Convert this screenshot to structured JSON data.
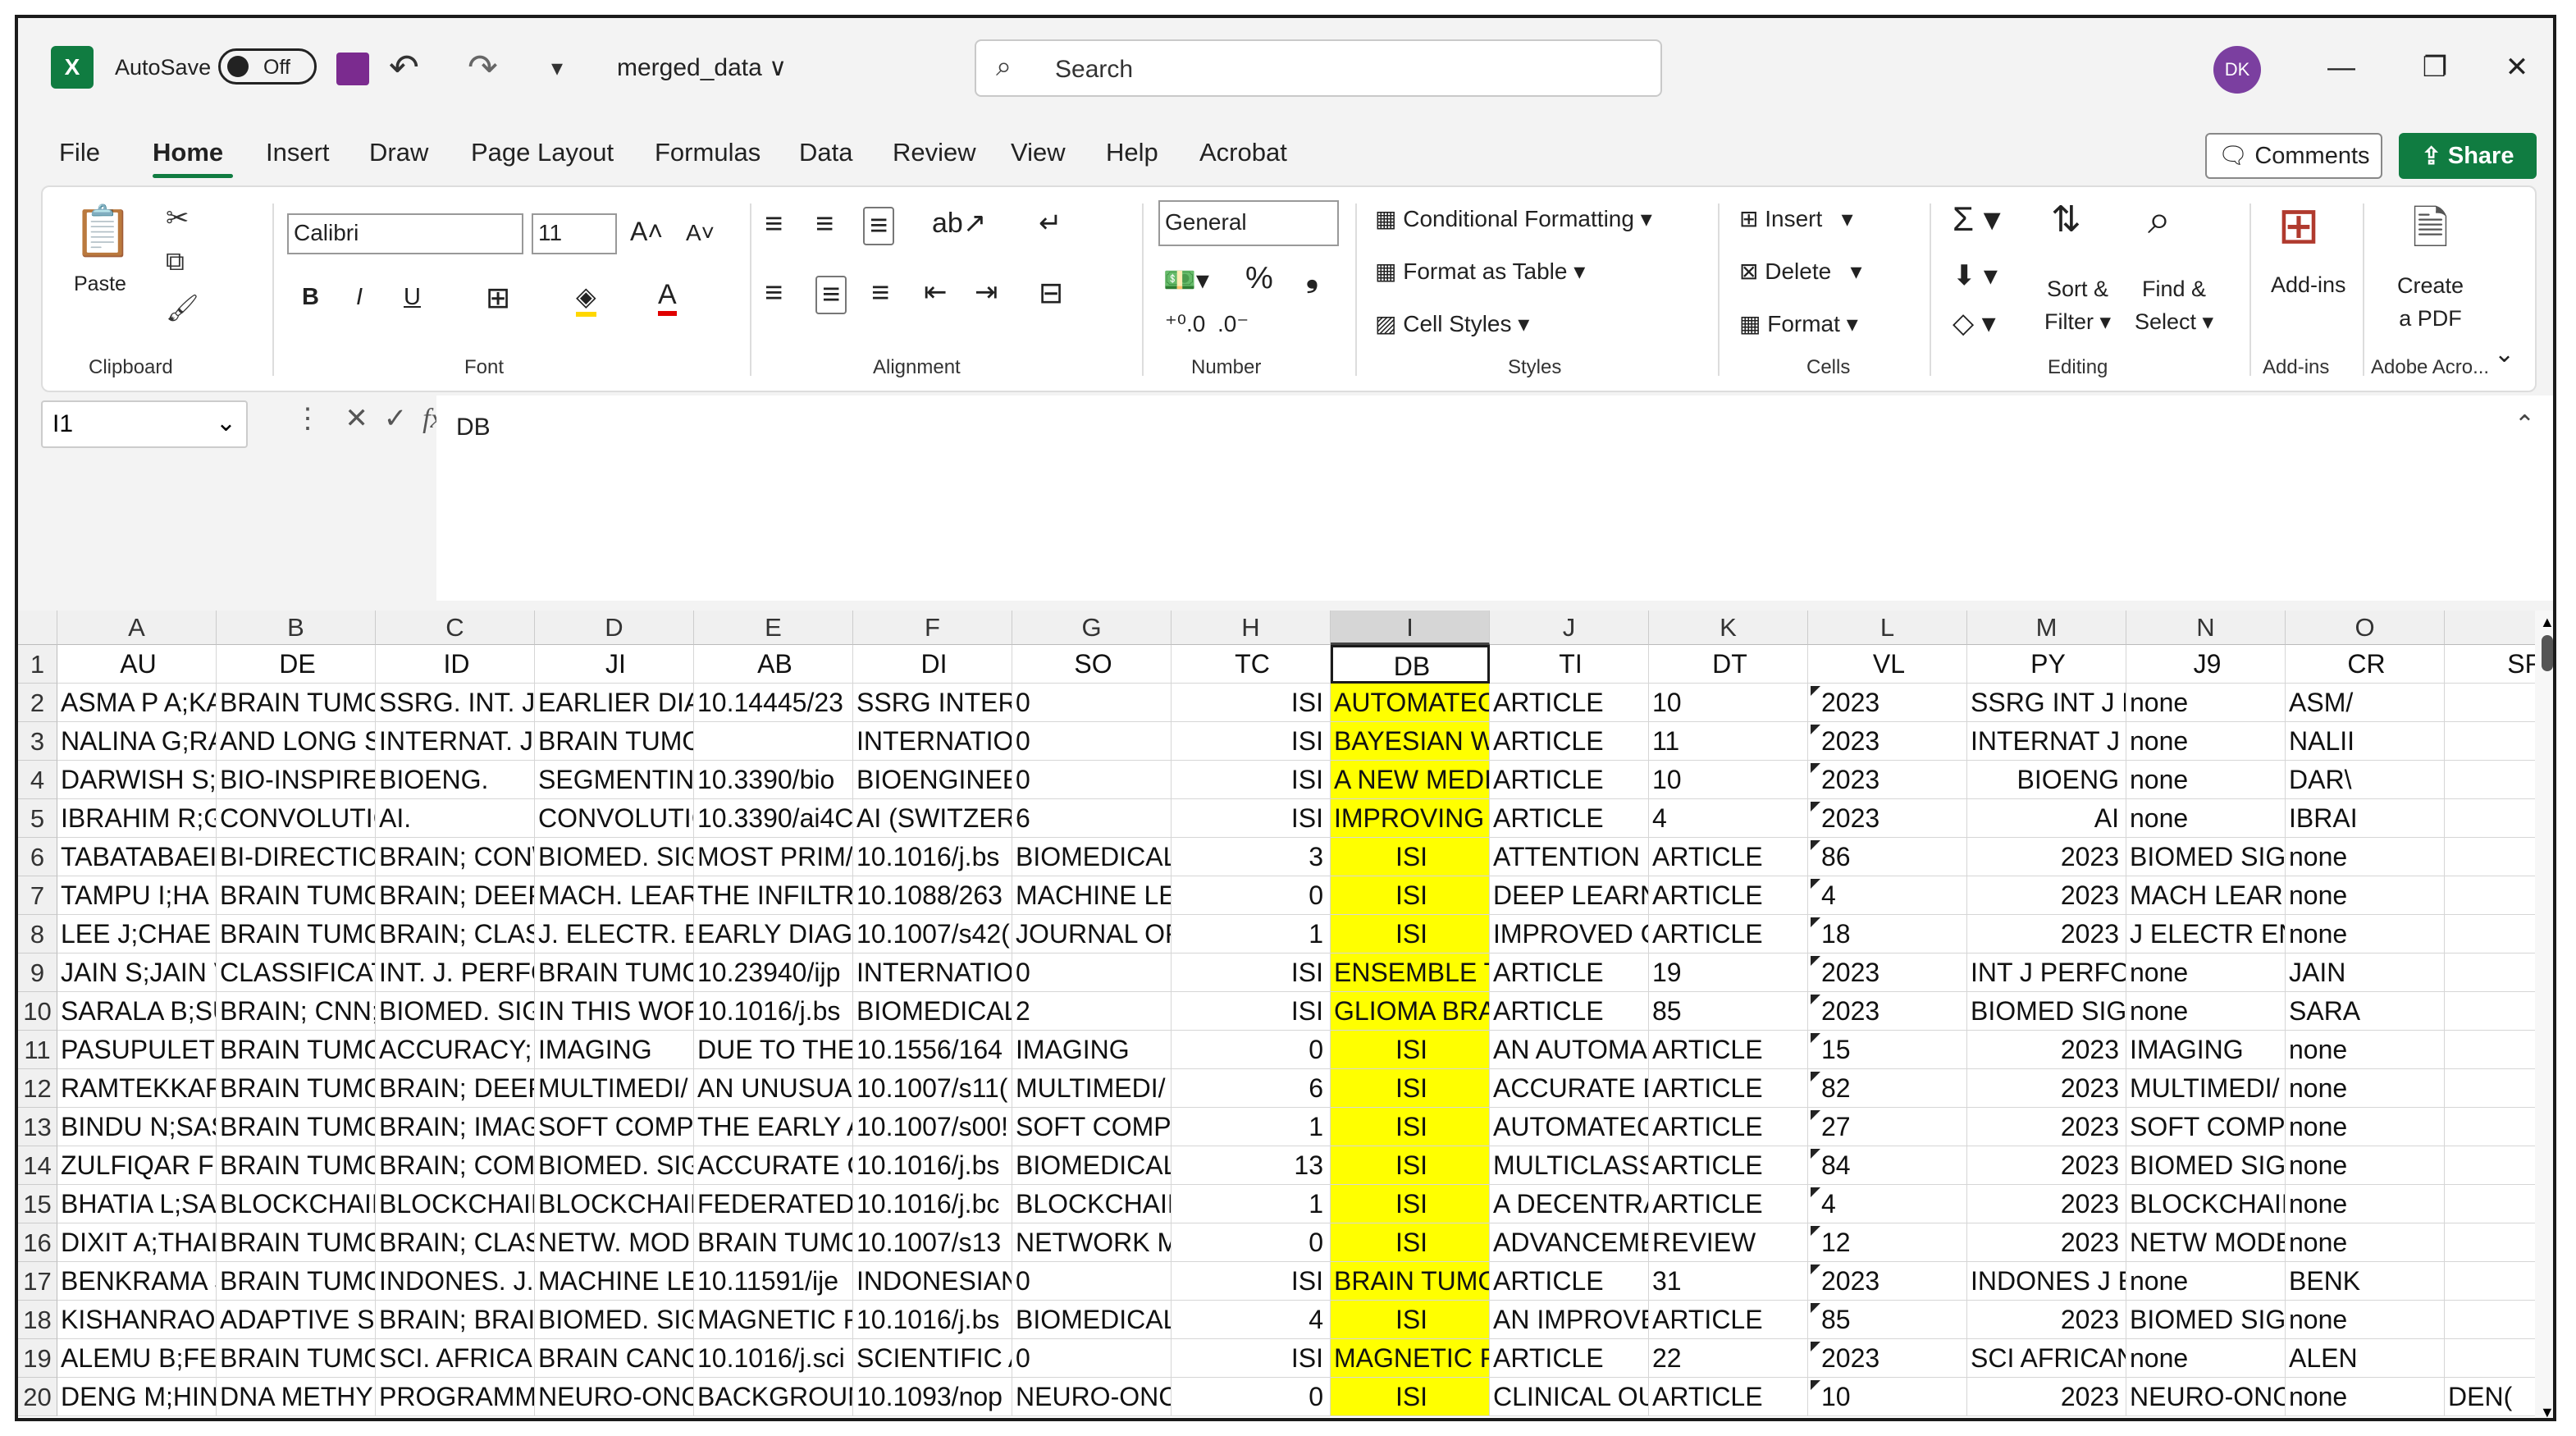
{
  "titlebar": {
    "autosave_label": "AutoSave",
    "autosave_state": "Off",
    "file_title": "merged_data ∨",
    "search_placeholder": "Search",
    "avatar_initials": "DK"
  },
  "tabs": [
    "File",
    "Home",
    "Insert",
    "Draw",
    "Page Layout",
    "Formulas",
    "Data",
    "Review",
    "View",
    "Help",
    "Acrobat"
  ],
  "active_tab": "Home",
  "actions": {
    "comments": "Comments",
    "share": "Share"
  },
  "ribbon": {
    "clipboard": {
      "paste": "Paste",
      "label": "Clipboard"
    },
    "font": {
      "name": "Calibri",
      "size": "11",
      "label": "Font"
    },
    "alignment": {
      "label": "Alignment"
    },
    "number": {
      "format": "General",
      "label": "Number"
    },
    "styles": {
      "conditional": "Conditional Formatting",
      "table": "Format as Table",
      "cell": "Cell Styles",
      "label": "Styles"
    },
    "cells": {
      "insert": "Insert",
      "delete": "Delete",
      "format": "Format",
      "label": "Cells"
    },
    "editing": {
      "sort": "Sort &",
      "sort2": "Filter",
      "find": "Find &",
      "find2": "Select",
      "label": "Editing"
    },
    "addins": {
      "btn": "Add-ins",
      "label": "Add-ins"
    },
    "adobe": {
      "btn1": "Create",
      "btn2": "a PDF",
      "label": "Adobe Acro..."
    }
  },
  "formula_bar": {
    "name_box": "I1",
    "formula": "DB"
  },
  "sheet": {
    "columns": [
      "A",
      "B",
      "C",
      "D",
      "E",
      "F",
      "G",
      "H",
      "I",
      "J",
      "K",
      "L",
      "M",
      "N",
      "O",
      ""
    ],
    "selected_column": "I",
    "header_row": [
      "AU",
      "DE",
      "ID",
      "JI",
      "AB",
      "DI",
      "SO",
      "TC",
      "DB",
      "TI",
      "DT",
      "VL",
      "PY",
      "J9",
      "CR",
      "SR"
    ],
    "rows": [
      [
        "ASMA P A;KA",
        "BRAIN TUMOUR; COMPUT",
        "SSRG. INT. J.",
        "EARLIER DIA(",
        "10.14445/23",
        "SSRG INTERN",
        "0",
        "ISI",
        "AUTOMATEC",
        "ARTICLE",
        "10",
        "2023",
        "SSRG INT J EL",
        "none",
        "ASM/"
      ],
      [
        "NALINA G;RA",
        "AND LONG SHORT-TERM M",
        "INTERNAT. J.",
        "BRAIN TUMOR CLASSIFICA",
        "",
        "INTERNATIOI",
        "0",
        "ISI",
        "BAYESIAN W",
        "ARTICLE",
        "11",
        "2023",
        "INTERNAT J I",
        "none",
        "NALII"
      ],
      [
        "DARWISH S;/",
        "BIO-INSPIRED CLUSTERINC",
        "BIOENG.",
        "SEGMENTIN(",
        "10.3390/bio",
        "BIOENGINEE",
        "0",
        "ISI",
        "A NEW MEDI",
        "ARTICLE",
        "10",
        "2023",
        "BIOENG",
        "none",
        "DAR\\"
      ],
      [
        "IBRAHIM R;G",
        "CONVOLUTIONAL NEURAL",
        "AI.",
        "CONVOLUTIC",
        "10.3390/ai4C",
        "AI (SWITZERI",
        "6",
        "ISI",
        "IMPROVING ,",
        "ARTICLE",
        "4",
        "2023",
        "AI",
        "none",
        "IBRAI"
      ],
      [
        "TABATABAEI",
        "BI-DIRECTIOI",
        "BRAIN; CON\\",
        "BIOMED. SIG",
        "MOST PRIM/",
        "10.1016/j.bs",
        "BIOMEDICAL",
        "3",
        "ISI",
        "ATTENTION 1",
        "ARTICLE",
        "86",
        "2023",
        "BIOMED SIGI",
        "none"
      ],
      [
        "TAMPU I;HA",
        "BRAIN TUMC",
        "BRAIN; DEEP",
        "MACH. LEAR",
        "THE INFILTR/",
        "10.1088/263",
        "MACHINE LE.",
        "0",
        "ISI",
        "DEEP LEARNI",
        "ARTICLE",
        "4",
        "2023",
        "MACH LEARN",
        "none"
      ],
      [
        "LEE J;CHAE J;",
        "BRAIN TUMC",
        "BRAIN; CLAS:",
        "J. ELECTR. EN",
        "EARLY DIAGN",
        "10.1007/s42(",
        "JOURNAL OF",
        "1",
        "ISI",
        "IMPROVED C",
        "ARTICLE",
        "18",
        "2023",
        "J ELECTR ENG",
        "none"
      ],
      [
        "JAIN S;JAIN V",
        "CLASSIFICATION; ENSEMB",
        "INT. J. PERFC",
        "BRAIN TUMC",
        "10.23940/ijp",
        "INTERNATIOI",
        "0",
        "ISI",
        "ENSEMBLE T",
        "ARTICLE",
        "19",
        "2023",
        "INT J PERFOR",
        "none",
        "JAIN"
      ],
      [
        "SARALA B;SU",
        "BRAIN; CNN; BRAIN; BRAII",
        "BIOMED. SIG",
        "IN THIS WOR",
        "10.1016/j.bs",
        "BIOMEDICAL",
        "2",
        "ISI",
        "GLIOMA BRA",
        "ARTICLE",
        "85",
        "2023",
        "BIOMED SIGI",
        "none",
        "SARA"
      ],
      [
        "PASUPULETI",
        "BRAIN TUMC",
        "ACCURACY; /",
        "IMAGING",
        "DUE TO THE",
        "10.1556/164",
        "IMAGING",
        "0",
        "ISI",
        "AN AUTOMA",
        "ARTICLE",
        "15",
        "2023",
        "IMAGING",
        "none"
      ],
      [
        "RAMTEKKAR",
        "BRAIN TUMC",
        "BRAIN; DEEP",
        "MULTIMEDI/",
        "AN UNUSUAI",
        "10.1007/s11(",
        "MULTIMEDI/",
        "6",
        "ISI",
        "ACCURATE D",
        "ARTICLE",
        "82",
        "2023",
        "MULTIMEDI/",
        "none"
      ],
      [
        "BINDU N;SAS",
        "BRAIN TUMC",
        "BRAIN; IMAG",
        "SOFT COMPL",
        "THE EARLY A",
        "10.1007/s00!",
        "SOFT COMPL",
        "1",
        "ISI",
        "AUTOMATEC",
        "ARTICLE",
        "27",
        "2023",
        "SOFT COMPL",
        "none"
      ],
      [
        "ZULFIQAR F;I",
        "BRAIN TUMC",
        "BRAIN; COM",
        "BIOMED. SIG",
        "ACCURATE C",
        "10.1016/j.bs",
        "BIOMEDICAL",
        "13",
        "ISI",
        "MULTICLASS",
        "ARTICLE",
        "84",
        "2023",
        "BIOMED SIGI",
        "none"
      ],
      [
        "BHATIA L;SAI",
        "BLOCKCHAIN",
        "BLOCKCHAIN",
        "BLOCKCHAIN",
        "FEDERATED I",
        "10.1016/j.bc",
        "BLOCKCHAIN",
        "1",
        "ISI",
        "A DECENTRA",
        "ARTICLE",
        "4",
        "2023",
        "BLOCKCHAIN",
        "none"
      ],
      [
        "DIXIT A;THAI",
        "BRAIN TUMC",
        "BRAIN; CLAS:",
        "NETW. MOD",
        "BRAIN TUMC",
        "10.1007/s13",
        "NETWORK M",
        "0",
        "ISI",
        "ADVANCEME",
        "REVIEW",
        "12",
        "2023",
        "NETW MODE",
        "none"
      ],
      [
        "BENKRAMA S",
        "BRAIN TUMORS; CONVOLI",
        "INDONES. J.",
        "MACHINE LE.",
        "10.11591/ije",
        "INDONESIAN",
        "0",
        "ISI",
        "BRAIN TUMC",
        "ARTICLE",
        "31",
        "2023",
        "INDONES J EI",
        "none",
        "BENK"
      ],
      [
        "KISHANRAO",
        "ADAPTIVE SL",
        "BRAIN; BRAII",
        "BIOMED. SIG",
        "MAGNETIC R",
        "10.1016/j.bs",
        "BIOMEDICAL",
        "4",
        "ISI",
        "AN IMPROVE",
        "ARTICLE",
        "85",
        "2023",
        "BIOMED SIGI",
        "none"
      ],
      [
        "ALEMU B;FEI",
        "BRAIN TUMOR; CLASSIFIC/",
        "SCI. AFRICAN",
        "BRAIN CANCI",
        "10.1016/j.sci",
        "SCIENTIFIC A",
        "0",
        "ISI",
        "MAGNETIC R",
        "ARTICLE",
        "22",
        "2023",
        "SCI AFRICAN",
        "none",
        "ALEN"
      ],
      [
        "DENG M;HIN",
        "DNA METHYI",
        "PROGRAMM",
        "NEURO-ONC",
        "BACKGROUN",
        "10.1093/nop",
        "NEURO-ONC",
        "0",
        "ISI",
        "CLINICAL OU",
        "ARTICLE",
        "10",
        "2023",
        "NEURO-ONC",
        "none",
        "DEN("
      ]
    ]
  },
  "colors": {
    "accent": "#107c41",
    "highlight": "#ffff00"
  }
}
